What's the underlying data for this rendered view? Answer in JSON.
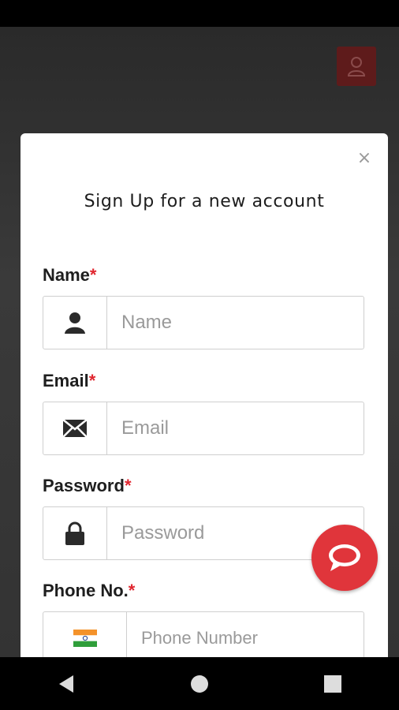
{
  "modal": {
    "title": "Sign Up for a new account",
    "close_label": "×"
  },
  "form": {
    "required_marker": "*",
    "name": {
      "label": "Name",
      "placeholder": "Name",
      "icon": "user-icon"
    },
    "email": {
      "label": "Email",
      "placeholder": "Email",
      "icon": "envelope-icon"
    },
    "password": {
      "label": "Password",
      "placeholder": "Password",
      "icon": "lock-icon"
    },
    "phone": {
      "label": "Phone No.",
      "placeholder": "Phone Number",
      "icon": "india-flag-icon"
    }
  },
  "colors": {
    "accent": "#e0353b",
    "required": "#e0262f",
    "backdrop_button": "#5e1b1b"
  },
  "icons": {
    "header_user": "user-outline-icon",
    "chat": "chat-bubble-icon",
    "nav_back": "back-triangle-icon",
    "nav_home": "home-circle-icon",
    "nav_recents": "recents-square-icon"
  }
}
